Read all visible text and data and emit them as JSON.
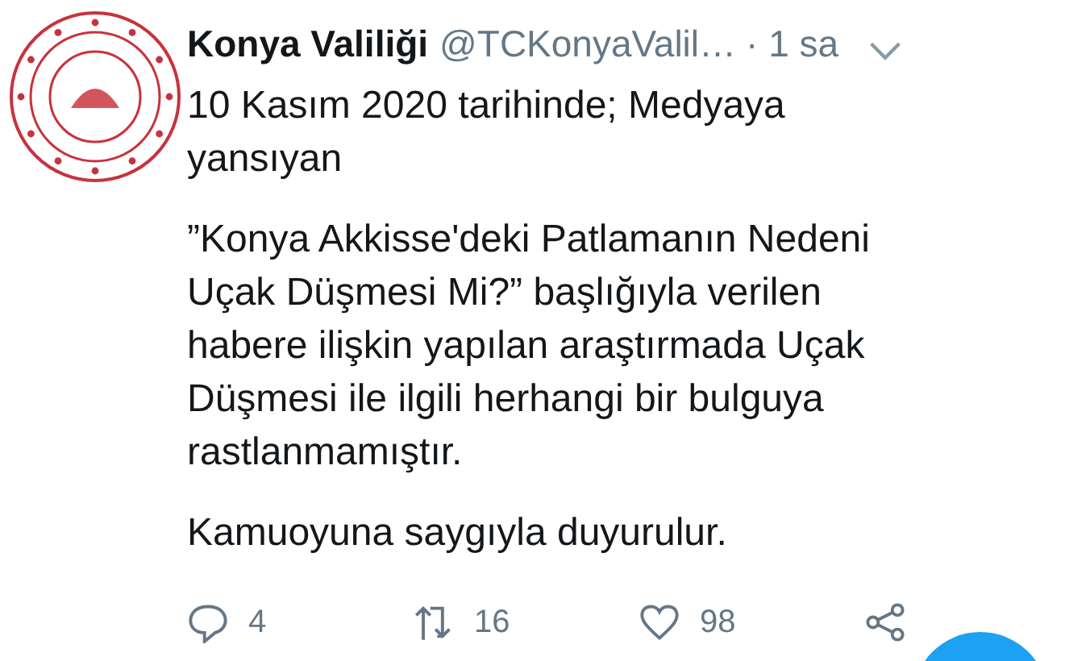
{
  "tweet": {
    "display_name": "Konya Valiliği",
    "handle": "@TCKonyaValil…",
    "time": "· 1 sa",
    "paragraphs": [
      [
        "10 Kasım 2020 tarihinde; Medyaya",
        "yansıyan"
      ],
      [
        "”Konya Akkisse'deki Patlamanın Nedeni",
        "Uçak Düşmesi Mi?”  başlığıyla verilen",
        "habere ilişkin yapılan araştırmada Uçak",
        "Düşmesi ile ilgili herhangi bir bulguya",
        "rastlanmamıştır."
      ],
      [
        "Kamuoyuna saygıyla duyurulur."
      ]
    ],
    "actions": [
      {
        "kind": "reply",
        "count": "4"
      },
      {
        "kind": "retweet",
        "count": "16"
      },
      {
        "kind": "like",
        "count": "98"
      },
      {
        "kind": "share"
      }
    ]
  }
}
